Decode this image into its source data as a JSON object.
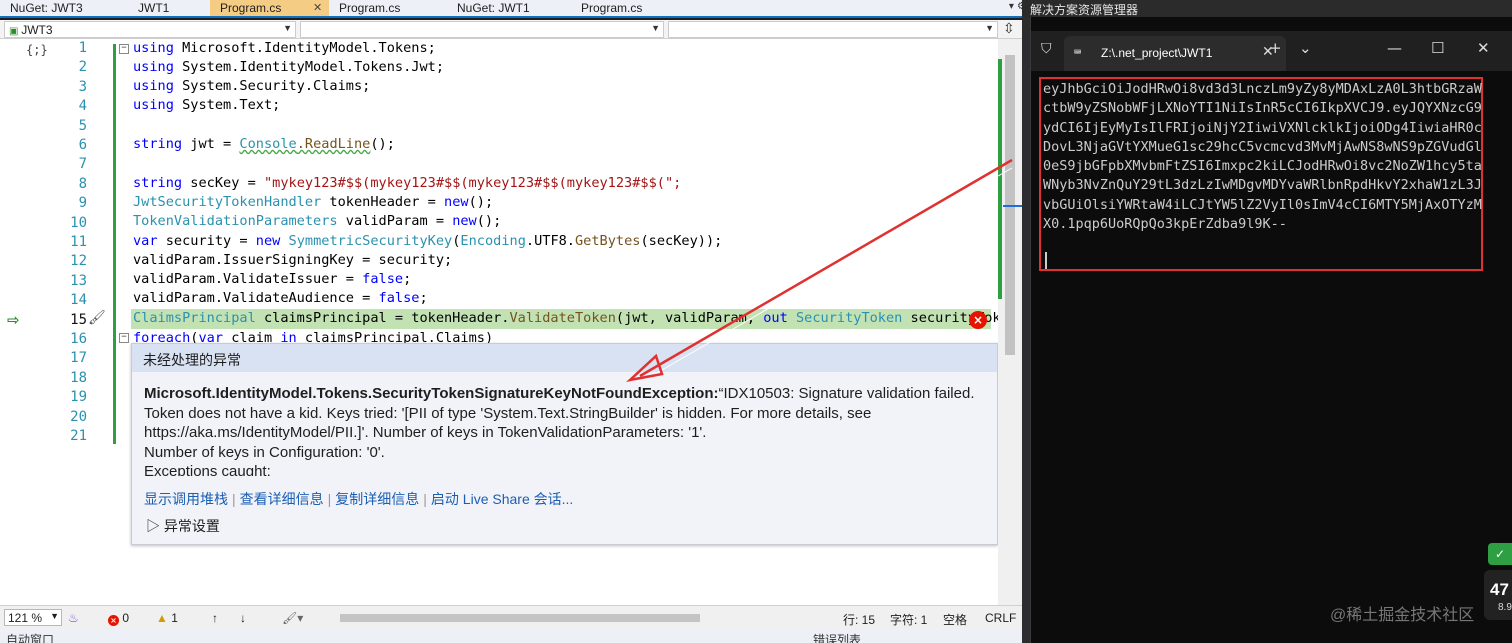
{
  "vs": {
    "tabs": [
      {
        "label": "NuGet: JWT3",
        "active": false
      },
      {
        "label": "JWT1",
        "active": false
      },
      {
        "label": "Program.cs",
        "active": true
      },
      {
        "label": "Program.cs",
        "active": false
      },
      {
        "label": "NuGet: JWT1",
        "active": false
      },
      {
        "label": "Program.cs",
        "active": false
      }
    ],
    "close_glyph": "✕",
    "navbar": {
      "project": "JWT3",
      "member": "",
      "extra": ""
    },
    "line_numbers": [
      "1",
      "2",
      "3",
      "4",
      "5",
      "6",
      "7",
      "8",
      "9",
      "10",
      "11",
      "12",
      "13",
      "14",
      "15",
      "16",
      "17",
      "18",
      "19",
      "20",
      "21"
    ],
    "current_line": "15",
    "code": {
      "l1": {
        "kw": "using",
        "rest": " Microsoft.IdentityModel.Tokens;"
      },
      "l2": {
        "kw": "using",
        "rest": " System.IdentityModel.Tokens.Jwt;"
      },
      "l3": {
        "kw": "using",
        "rest": " System.Security.Claims;"
      },
      "l4": {
        "kw": "using",
        "rest": " System.Text;"
      },
      "l6": {
        "kw": "string",
        "var": " jwt = ",
        "tp": "Console",
        "mth": ".ReadLine",
        "end": "();"
      },
      "l8": {
        "kw": "string",
        "var": " secKey = ",
        "str": "\"mykey123#$$(mykey123#$$(mykey123#$$(mykey123#$$(\";"
      },
      "l9": {
        "tp": "JwtSecurityTokenHandler",
        "var": " tokenHeader = ",
        "kw": "new",
        "end": "();"
      },
      "l10": {
        "tp": "TokenValidationParameters",
        "var": " validParam = ",
        "kw": "new",
        "end": "();"
      },
      "l11": {
        "kw": "var",
        "var": " security = ",
        "kw2": "new",
        "tp": " SymmetricSecurityKey",
        "mid": "(",
        "tp2": "Encoding",
        "mid2": ".UTF8.",
        "mth": "GetBytes",
        "end": "(secKey));"
      },
      "l12": "validParam.IssuerSigningKey = security;",
      "l13": {
        "var": "validParam.ValidateIssuer = ",
        "kw": "false",
        "end": ";"
      },
      "l14": {
        "var": "validParam.ValidateAudience = ",
        "kw": "false",
        "end": ";"
      },
      "l15": {
        "tp": "ClaimsPrincipal",
        "var": " claimsPrincipal = tokenHeader.",
        "mth": "ValidateToken",
        "mid": "(jwt, validParam, ",
        "kw": "out",
        "tp2": " SecurityToken",
        "end": " securityToke"
      },
      "l16": {
        "kw": "foreach",
        "mid": "(",
        "kw2": "var",
        "var": " claim ",
        "kw3": "in",
        "end": " claimsPrincipal.Claims)"
      }
    },
    "exception": {
      "header": "未经处理的异常",
      "type": "Microsoft.IdentityModel.Tokens.SecurityTokenSignatureKeyNotFoundException:",
      "message": "“IDX10503: Signature validation failed. Token does not have a kid. Keys tried: '[PII of type 'System.Text.StringBuilder' is hidden. For more details, see https://aka.ms/IdentityModel/PII.]'. Number of keys in TokenValidationParameters: '1'.",
      "line2": "Number of keys in Configuration: '0'.",
      "line3": "Exceptions caught:",
      "links": [
        "显示调用堆栈",
        "查看详细信息",
        "复制详细信息",
        "启动 Live Share 会话..."
      ],
      "settings": "异常设置"
    },
    "status": {
      "zoom": "121 %",
      "errors": "0",
      "warnings": "1",
      "line": "行: 15",
      "char": "字符: 1",
      "space": "空格",
      "eol": "CRLF"
    },
    "bottom_left": "自动窗口",
    "bottom_right": "错误列表"
  },
  "solution_explorer_title": "解决方案资源管理器",
  "terminal": {
    "tab_title": "Z:\\.net_project\\JWT1",
    "new_tab": "+",
    "dropdown": "⌄",
    "minimize": "—",
    "maximize": "☐",
    "close": "✕",
    "output": "eyJhbGciOiJodHRwOi8vd3d3LnczLm9yZy8yMDAxLzA0L3htbGRzaWctbW9yZSNobWFjLXNoYTI1NiIsInR5cCI6IkpXVCJ9.eyJQYXNzcG9ydCI6IjEyMyIsIlFRIjoiNjY2IiwiVXNlcklkIjoiODg4IiwiaHR0cDovL3NjaGVtYXMueG1sc29hcC5vcmcvd3MvMjAwNS8wNS9pZGVudGl0eS9jbGFpbXMvbmFtZSI6Imxpc2kiLCJodHRwOi8vc2NoZW1hcy5taWNyb3NvZnQuY29tL3dzLzIwMDgvMDYvaWRlbnRpdHkvY2xhaW1zL3JvbGUiOlsiYWRtaW4iLCJtYW5lZ2VyIl0sImV4cCI6MTY5MjAxOTYzMX0.1pqp6UoRQpQo3kpErZdba9l9K--"
  },
  "badges": {
    "shield": "✓",
    "perf_num": "47",
    "perf_sub": "8.9"
  },
  "watermark": "@稀土掘金技术社区",
  "colors": {
    "error_red": "#e51400",
    "vs_accent": "#0e70c0",
    "highlight": "#c3e2b4",
    "annotation": "#e03131"
  }
}
